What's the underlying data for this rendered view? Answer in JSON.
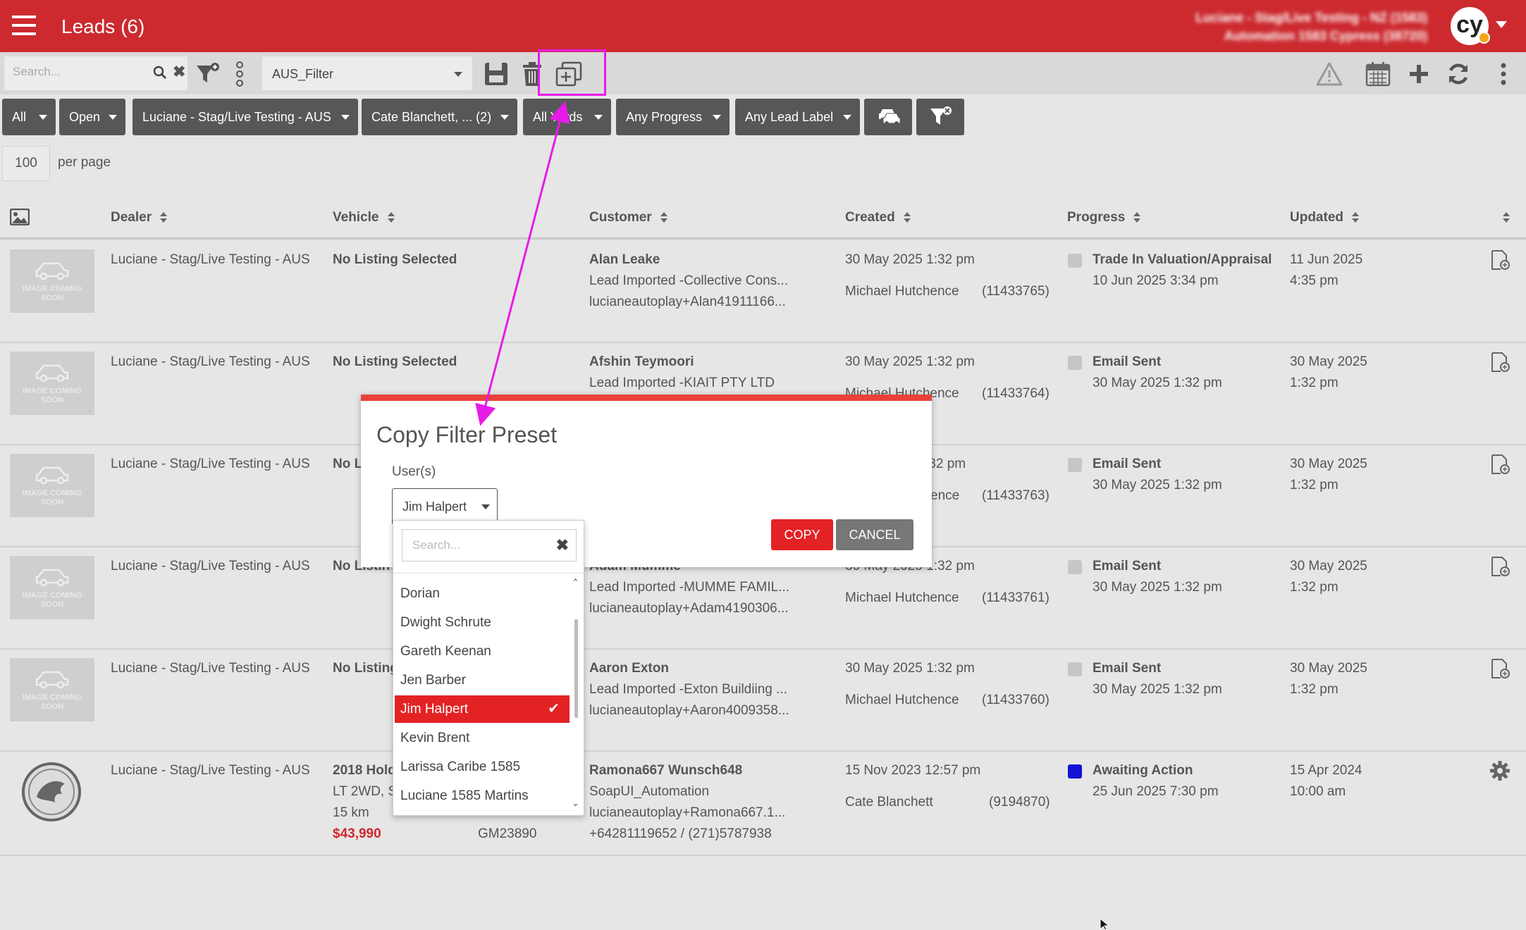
{
  "header": {
    "title": "Leads (6)",
    "account_line1": "Luciane - Stag/Live Testing - NZ (1583)",
    "account_line2": "Automation 1583 Cypress (38720)",
    "avatar_text": "cy"
  },
  "toolbar": {
    "search_placeholder": "Search...",
    "preset_value": "AUS_Filter"
  },
  "filters": [
    {
      "label": "All"
    },
    {
      "label": "Open"
    },
    {
      "label": "Luciane - Stag/Live Testing - AUS"
    },
    {
      "label": "Cate Blanchett, ... (2)"
    },
    {
      "label": "All Yards"
    },
    {
      "label": "Any Progress"
    },
    {
      "label": "Any Lead Label"
    }
  ],
  "pagination": {
    "per_page_value": "100",
    "per_page_label": "per page"
  },
  "columns": {
    "dealer": "Dealer",
    "vehicle": "Vehicle",
    "customer": "Customer",
    "created": "Created",
    "progress": "Progress",
    "updated": "Updated"
  },
  "placeholder_image": {
    "line1": "IMAGE COMING",
    "line2": "SOON"
  },
  "rows": [
    {
      "dealer": "Luciane - Stag/Live Testing - AUS",
      "vehicle": "No Listing Selected",
      "customer": "Alan Leake",
      "customer_line2": "Lead Imported -Collective Cons...",
      "customer_line3": "lucianeautoplay+Alan41911166...",
      "created": "30 May 2025 1:32 pm",
      "agent": "Michael Hutchence",
      "lead_id": "(11433765)",
      "progress": "Trade In Valuation/Appraisal",
      "progress_date": "10 Jun 2025 3:34 pm",
      "updated_date": "11 Jun 2025",
      "updated_time": "4:35 pm"
    },
    {
      "dealer": "Luciane - Stag/Live Testing - AUS",
      "vehicle": "No Listing Selected",
      "customer": "Afshin Teymoori",
      "customer_line2": "Lead Imported -KIAIT PTY LTD",
      "customer_line3": "",
      "created": "30 May 2025 1:32 pm",
      "agent": "Michael Hutchence",
      "lead_id": "(11433764)",
      "progress": "Email Sent",
      "progress_date": "30 May 2025 1:32 pm",
      "updated_date": "30 May 2025",
      "updated_time": "1:32 pm"
    },
    {
      "dealer": "Luciane - Stag/Live Testing - AUS",
      "vehicle": "No L",
      "customer": "",
      "customer_line2": "",
      "customer_line3": "",
      "created": ":32 pm",
      "agent": "ence",
      "lead_id": "(11433763)",
      "progress": "Email Sent",
      "progress_date": "30 May 2025 1:32 pm",
      "updated_date": "30 May 2025",
      "updated_time": "1:32 pm"
    },
    {
      "dealer": "Luciane - Stag/Live Testing - AUS",
      "vehicle": "No Listin",
      "customer": "Adam Mumme",
      "customer_line2": "Lead Imported -MUMME FAMIL...",
      "customer_line3": "lucianeautoplay+Adam4190306...",
      "created": "30 May 2025 1:32 pm",
      "agent": "Michael Hutchence",
      "lead_id": "(11433761)",
      "progress": "Email Sent",
      "progress_date": "30 May 2025 1:32 pm",
      "updated_date": "30 May 2025",
      "updated_time": "1:32 pm"
    },
    {
      "dealer": "Luciane - Stag/Live Testing - AUS",
      "vehicle": "No Listing",
      "customer": "Aaron Exton",
      "customer_line2": "Lead Imported -Exton Buildiing ...",
      "customer_line3": "lucianeautoplay+Aaron4009358...",
      "created": "30 May 2025 1:32 pm",
      "agent": "Michael Hutchence",
      "lead_id": "(11433760)",
      "progress": "Email Sent",
      "progress_date": "30 May 2025 1:32 pm",
      "updated_date": "30 May 2025",
      "updated_time": "1:32 pm"
    },
    {
      "dealer": "Luciane - Stag/Live Testing - AUS",
      "vehicle": "2018 Hold",
      "vehicle_line2": "LT 2WD, S",
      "vehicle_line3": "15 km",
      "price": "$43,990",
      "stock": "GM23890",
      "customer": "Ramona667 Wunsch648",
      "customer_line2": "SoapUI_Automation",
      "customer_line3": "lucianeautoplay+Ramona667.1...",
      "customer_line4": "+64281119652 / (271)5787938",
      "created": "15 Nov 2023 12:57 pm",
      "agent": "Cate Blanchett",
      "lead_id": "(9194870)",
      "progress": "Awaiting Action",
      "progress_date": "25 Jun 2025 7:30 pm",
      "progress_color": "#1212d4",
      "updated_date": "15 Apr 2024",
      "updated_time": "10:00 am"
    }
  ],
  "modal": {
    "title": "Copy Filter Preset",
    "users_label": "User(s)",
    "selected_user": "Jim Halpert",
    "copy_label": "COPY",
    "cancel_label": "CANCEL"
  },
  "dropdown": {
    "search_placeholder": "Search...",
    "items": [
      "Dorian",
      "Dwight Schrute",
      "Gareth Keenan",
      "Jen Barber",
      "Jim Halpert",
      "Kevin Brent",
      "Larissa Caribe 1585",
      "Luciane 1585 Martins"
    ],
    "selected": "Jim Halpert"
  },
  "colors": {
    "brand": "#cc2a2f",
    "annotation": "#e61be8",
    "selected": "#e32224"
  }
}
